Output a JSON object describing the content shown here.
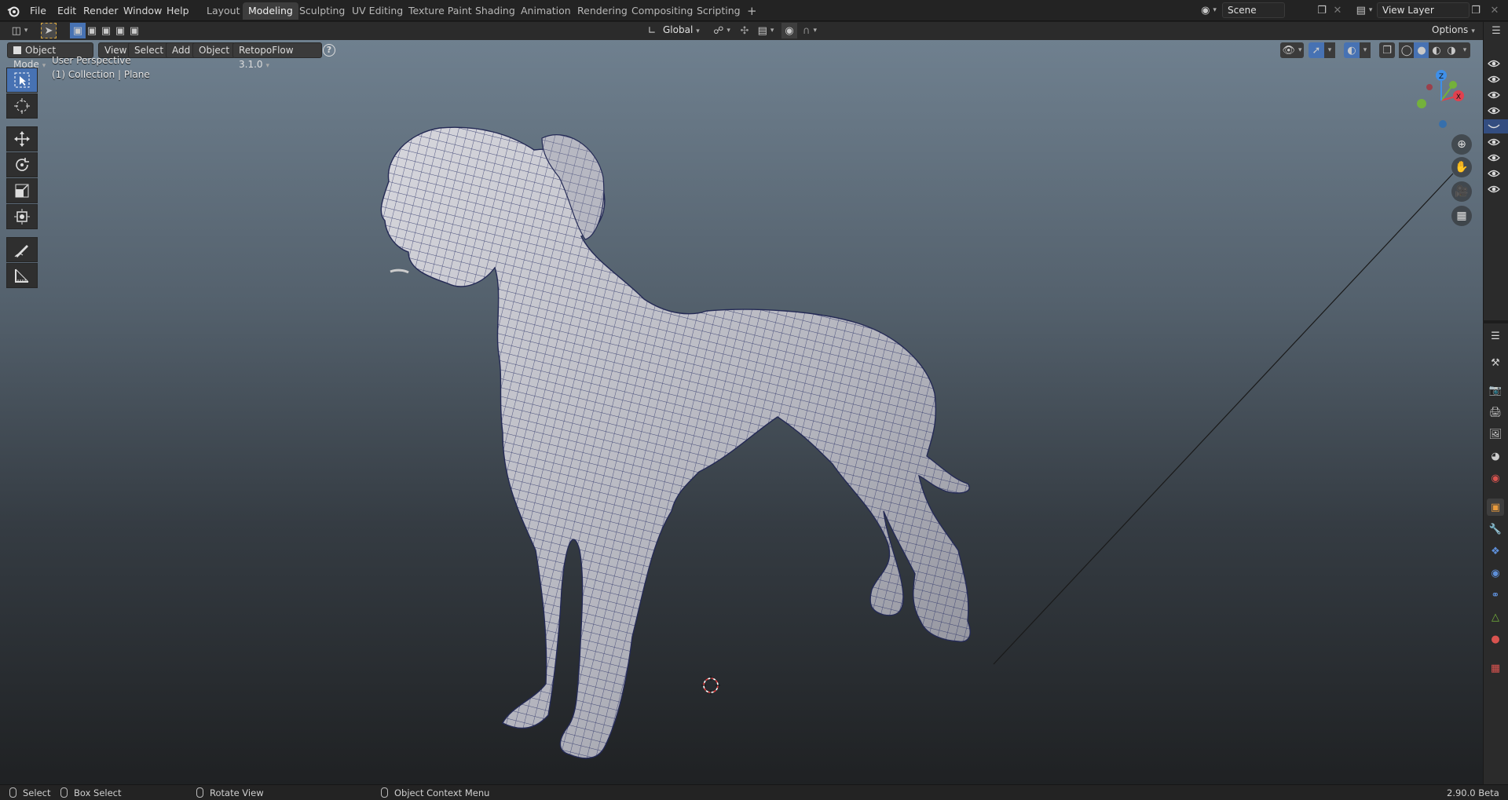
{
  "menu": {
    "items": [
      "File",
      "Edit",
      "Render",
      "Window",
      "Help"
    ]
  },
  "workspaces": {
    "tabs": [
      "Layout",
      "Modeling",
      "Sculpting",
      "UV Editing",
      "Texture Paint",
      "Shading",
      "Animation",
      "Rendering",
      "Compositing",
      "Scripting"
    ],
    "active": "Modeling",
    "add_label": "+"
  },
  "scene": {
    "name": "Scene"
  },
  "view_layer": {
    "name": "View Layer"
  },
  "tool_header": {
    "orientation": "Global",
    "options_label": "Options"
  },
  "viewport_header": {
    "mode": "Object Mode",
    "view": "View",
    "select": "Select",
    "add": "Add",
    "object": "Object",
    "addon": "RetopoFlow 3.1.0",
    "help": "?"
  },
  "viewport": {
    "perspective": "User Perspective",
    "collection": "(1) Collection | Plane"
  },
  "gizmo": {
    "x": "X",
    "y": "Y",
    "z": "Z"
  },
  "status": {
    "select": "Select",
    "box_select": "Box Select",
    "rotate_view": "Rotate View",
    "context_menu": "Object Context Menu",
    "version": "2.90.0 Beta"
  },
  "colors": {
    "accent": "#4772b3",
    "axis_x": "#e0414f",
    "axis_y": "#74b13b",
    "axis_z": "#3f8fe8"
  }
}
